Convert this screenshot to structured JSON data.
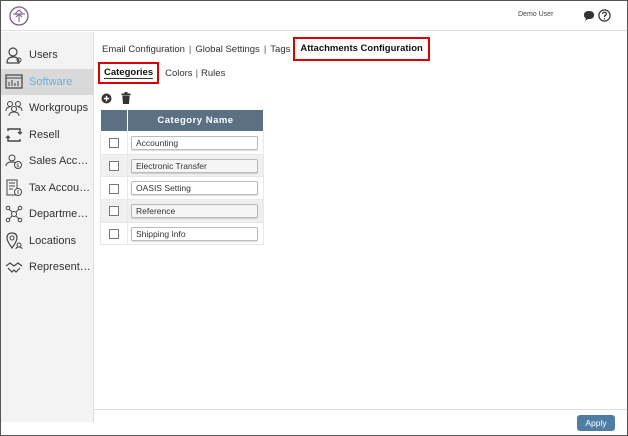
{
  "header": {
    "user_name": "Demo User",
    "icons": [
      "logo-icon",
      "chat-icon",
      "help-icon"
    ]
  },
  "sidebar": {
    "items": [
      {
        "label": "Users",
        "icon": "user-icon",
        "active": false
      },
      {
        "label": "Software",
        "icon": "software-icon",
        "active": true
      },
      {
        "label": "Workgroups",
        "icon": "workgroups-icon",
        "active": false
      },
      {
        "label": "Resell",
        "icon": "resell-icon",
        "active": false
      },
      {
        "label": "Sales Accounts",
        "icon": "sales-accounts-icon",
        "active": false
      },
      {
        "label": "Tax Accounts",
        "icon": "tax-accounts-icon",
        "active": false
      },
      {
        "label": "Departments",
        "icon": "departments-icon",
        "active": false
      },
      {
        "label": "Locations",
        "icon": "locations-icon",
        "active": false
      },
      {
        "label": "Representatives",
        "icon": "representatives-icon",
        "active": false
      }
    ]
  },
  "topnav": {
    "tabs": [
      {
        "label": "Email Configuration"
      },
      {
        "label": "Global Settings"
      },
      {
        "label": "Tags"
      },
      {
        "label": "Attachments Configuration"
      }
    ],
    "separator": "|"
  },
  "subnav": {
    "tabs": [
      {
        "label": "Categories"
      },
      {
        "label": "Colors"
      },
      {
        "label": "Rules"
      }
    ],
    "separator": "|"
  },
  "table": {
    "header": "Category Name",
    "rows": [
      {
        "name": "Accounting"
      },
      {
        "name": "Electronic Transfer"
      },
      {
        "name": "OASIS Setting"
      },
      {
        "name": "Reference"
      },
      {
        "name": "Shipping Info"
      }
    ]
  },
  "footer": {
    "apply_label": "Apply"
  },
  "colors": {
    "accent": "#6aaee0",
    "table_header": "#5b7083",
    "apply_button": "#4f7ea3",
    "highlight_box": "#dd0000"
  }
}
